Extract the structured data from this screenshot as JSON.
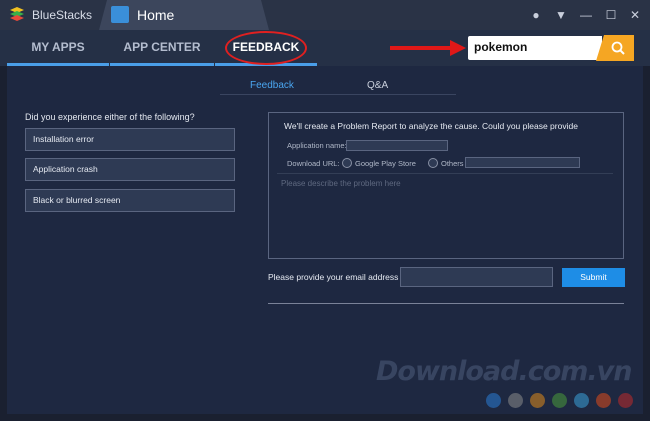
{
  "window": {
    "app_name": "BlueStacks",
    "tab_title": "Home"
  },
  "nav": {
    "tabs": [
      "MY APPS",
      "APP CENTER",
      "FEEDBACK"
    ],
    "search_value": "pokemon"
  },
  "feedback": {
    "subtabs": [
      "Feedback",
      "Q&A"
    ],
    "question": "Did you experience either of the following?",
    "options": [
      "Installation error",
      "Application crash",
      "Black or blurred screen"
    ],
    "report": {
      "title": "We'll create a Problem Report to analyze the cause. Could you please provide",
      "app_name_label": "Application name:",
      "download_url_label": "Download URL:",
      "source_options": [
        "Google Play Store",
        "Others"
      ],
      "description_placeholder": "Please describe the problem here"
    },
    "email_label": "Please provide your email address",
    "submit_label": "Submit"
  },
  "watermark": {
    "text": "Download.com.vn",
    "dot_colors": [
      "#2a7bd6",
      "#8a8a8a",
      "#e08a1a",
      "#4a9a3a",
      "#3aa0d8",
      "#e04a1a",
      "#c02a2a"
    ]
  },
  "colors": {
    "accent": "#1e8de6",
    "search_button": "#f5a623",
    "annotation": "#e01818"
  }
}
